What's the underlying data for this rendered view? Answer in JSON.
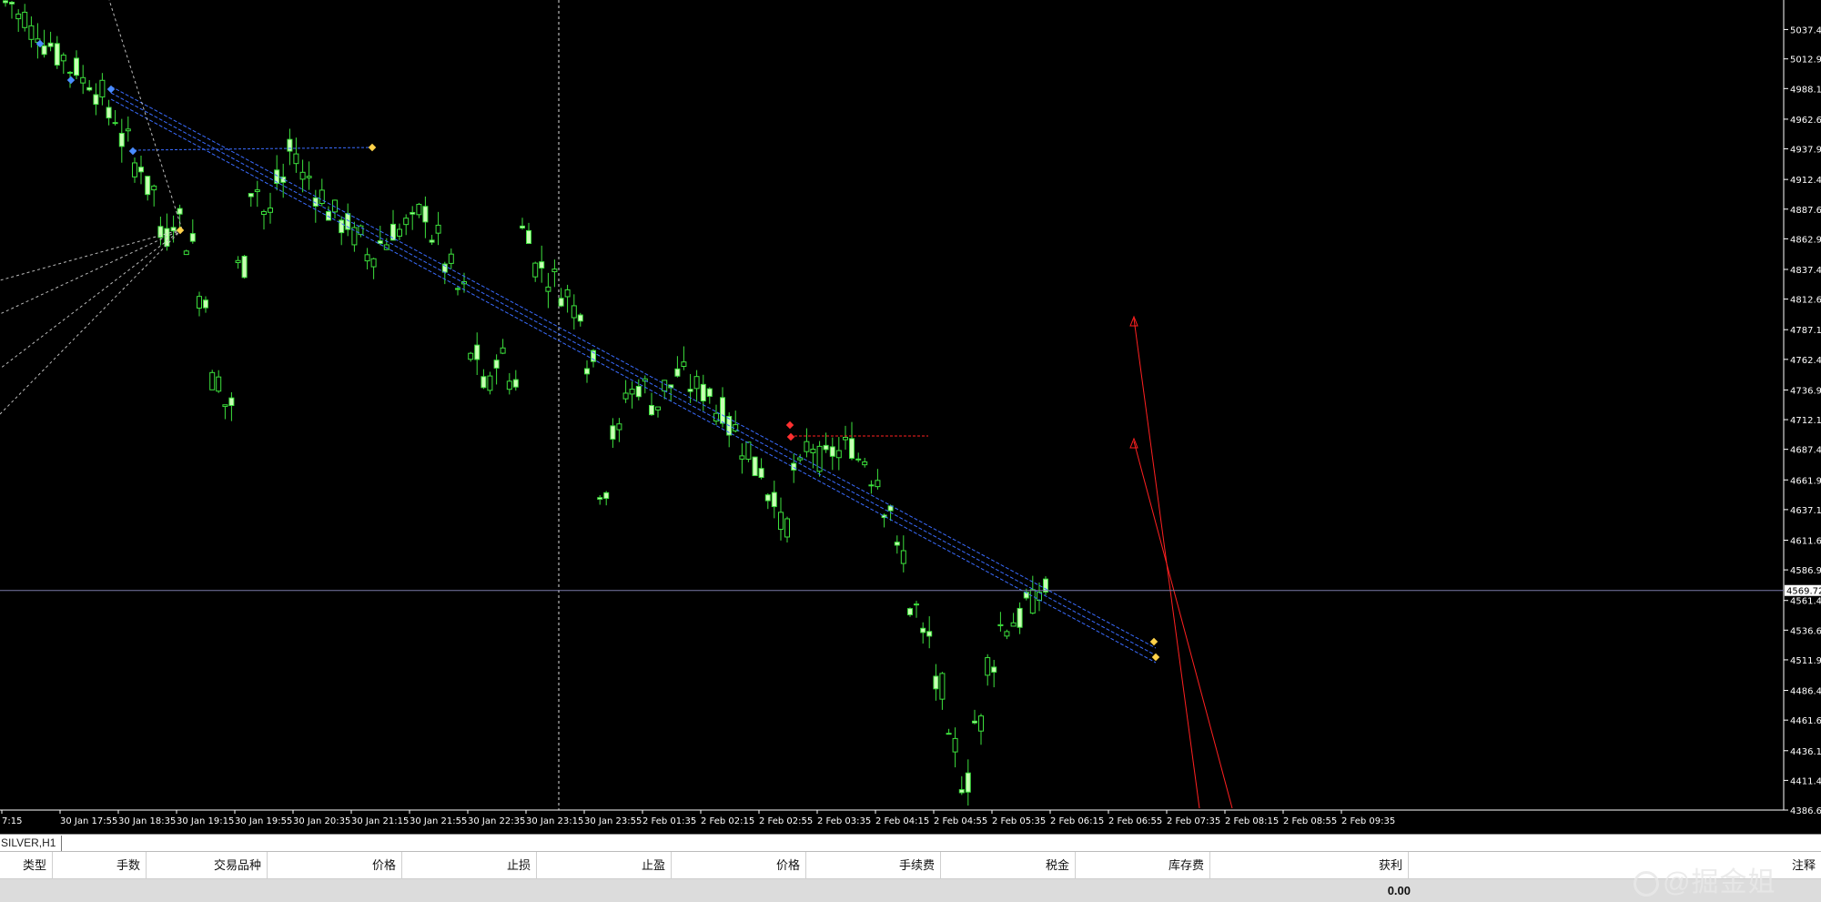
{
  "chart": {
    "symbol_tab": "SILVER,H1",
    "current_price": "4569.72",
    "price_ticks": [
      "5037.40",
      "5012.90",
      "4988.15",
      "4962.65",
      "4937.90",
      "4912.40",
      "4887.65",
      "4862.90",
      "4837.40",
      "4812.65",
      "4787.15",
      "4762.40",
      "4736.90",
      "4712.15",
      "4687.40",
      "4661.90",
      "4637.15",
      "4611.65",
      "4586.90",
      "4561.40",
      "4536.65",
      "4511.90",
      "4486.40",
      "4461.65",
      "4436.15",
      "4411.40",
      "4386.65"
    ],
    "time_ticks": [
      "7:15",
      "30 Jan 17:55",
      "30 Jan 18:35",
      "30 Jan 19:15",
      "30 Jan 19:55",
      "30 Jan 20:35",
      "30 Jan 21:15",
      "30 Jan 21:55",
      "30 Jan 22:35",
      "30 Jan 23:15",
      "30 Jan 23:55",
      "2 Feb 01:35",
      "2 Feb 02:15",
      "2 Feb 02:55",
      "2 Feb 03:35",
      "2 Feb 04:15",
      "2 Feb 04:55",
      "2 Feb 05:35",
      "2 Feb 06:15",
      "2 Feb 06:55",
      "2 Feb 07:35",
      "2 Feb 08:15",
      "2 Feb 08:55",
      "2 Feb 09:35"
    ],
    "colors": {
      "background": "#000000",
      "bull": "#c8ffb4",
      "bear": "#000000",
      "outline": "#3ce03c",
      "price_line": "#7a7aa8",
      "trend": "#3a6cff",
      "sell": "#ff2020",
      "axis_text": "#ffffff"
    }
  },
  "chart_data": {
    "type": "candlestick",
    "timeframe": "H1",
    "ylim": [
      4386.65,
      5062.0
    ],
    "x_ticks": [
      "7:15",
      "30 Jan 17:55",
      "30 Jan 18:35",
      "30 Jan 19:15",
      "30 Jan 19:55",
      "30 Jan 20:35",
      "30 Jan 21:15",
      "30 Jan 21:55",
      "30 Jan 22:35",
      "30 Jan 23:15",
      "30 Jan 23:55",
      "2 Feb 01:35",
      "2 Feb 02:15",
      "2 Feb 02:55",
      "2 Feb 03:35",
      "2 Feb 04:15",
      "2 Feb 04:55",
      "2 Feb 05:35",
      "2 Feb 06:15",
      "2 Feb 06:55",
      "2 Feb 07:35",
      "2 Feb 08:15",
      "2 Feb 08:55",
      "2 Feb 09:35"
    ],
    "close_path": [
      [
        0,
        5060
      ],
      [
        3,
        5025
      ],
      [
        5,
        5005
      ],
      [
        7,
        4985
      ],
      [
        9,
        4945
      ],
      [
        11,
        4905
      ],
      [
        12,
        4865
      ],
      [
        13,
        4880
      ],
      [
        14,
        4860
      ],
      [
        15,
        4815
      ],
      [
        16,
        4745
      ],
      [
        17,
        4725
      ],
      [
        18,
        4840
      ],
      [
        19,
        4905
      ],
      [
        20,
        4885
      ],
      [
        21,
        4910
      ],
      [
        22,
        4935
      ],
      [
        23,
        4915
      ],
      [
        25,
        4885
      ],
      [
        27,
        4865
      ],
      [
        28,
        4850
      ],
      [
        30,
        4870
      ],
      [
        31,
        4875
      ],
      [
        32,
        4885
      ],
      [
        33,
        4865
      ],
      [
        34,
        4840
      ],
      [
        35,
        4820
      ],
      [
        36,
        4765
      ],
      [
        37,
        4740
      ],
      [
        38,
        4765
      ],
      [
        39,
        4745
      ],
      [
        40,
        4870
      ],
      [
        41,
        4840
      ],
      [
        42,
        4830
      ],
      [
        44,
        4805
      ],
      [
        45,
        4760
      ],
      [
        46,
        4655
      ],
      [
        47,
        4700
      ],
      [
        48,
        4735
      ],
      [
        49,
        4740
      ],
      [
        50,
        4725
      ],
      [
        51,
        4740
      ],
      [
        52,
        4750
      ],
      [
        53,
        4740
      ],
      [
        54,
        4735
      ],
      [
        55,
        4720
      ],
      [
        56,
        4705
      ],
      [
        57,
        4690
      ],
      [
        58,
        4670
      ],
      [
        59,
        4650
      ],
      [
        60,
        4625
      ],
      [
        61,
        4670
      ],
      [
        62,
        4690
      ],
      [
        63,
        4680
      ],
      [
        64,
        4685
      ],
      [
        65,
        4690
      ],
      [
        66,
        4680
      ],
      [
        67,
        4665
      ],
      [
        68,
        4640
      ],
      [
        69,
        4600
      ],
      [
        70,
        4555
      ],
      [
        71,
        4530
      ],
      [
        72,
        4490
      ],
      [
        73,
        4440
      ],
      [
        74,
        4410
      ],
      [
        75,
        4460
      ],
      [
        76,
        4510
      ],
      [
        77,
        4540
      ],
      [
        78,
        4545
      ],
      [
        79,
        4560
      ],
      [
        80,
        4570
      ]
    ],
    "reference_levels": [
      {
        "price": 4569.72,
        "type": "current-price"
      },
      {
        "price": 4697.0,
        "type": "sell-level"
      }
    ]
  },
  "terminal": {
    "columns": [
      {
        "label": "类型",
        "key": "type"
      },
      {
        "label": "手数",
        "key": "lots"
      },
      {
        "label": "交易品种",
        "key": "symbol"
      },
      {
        "label": "价格",
        "key": "open_price"
      },
      {
        "label": "止损",
        "key": "sl"
      },
      {
        "label": "止盈",
        "key": "tp"
      },
      {
        "label": "价格",
        "key": "price"
      },
      {
        "label": "手续费",
        "key": "commission"
      },
      {
        "label": "税金",
        "key": "taxes"
      },
      {
        "label": "库存费",
        "key": "swap"
      },
      {
        "label": "获利",
        "key": "profit"
      },
      {
        "label": "注释",
        "key": "comment"
      }
    ],
    "total_profit": "0.00"
  },
  "watermark": "@掘金姐"
}
